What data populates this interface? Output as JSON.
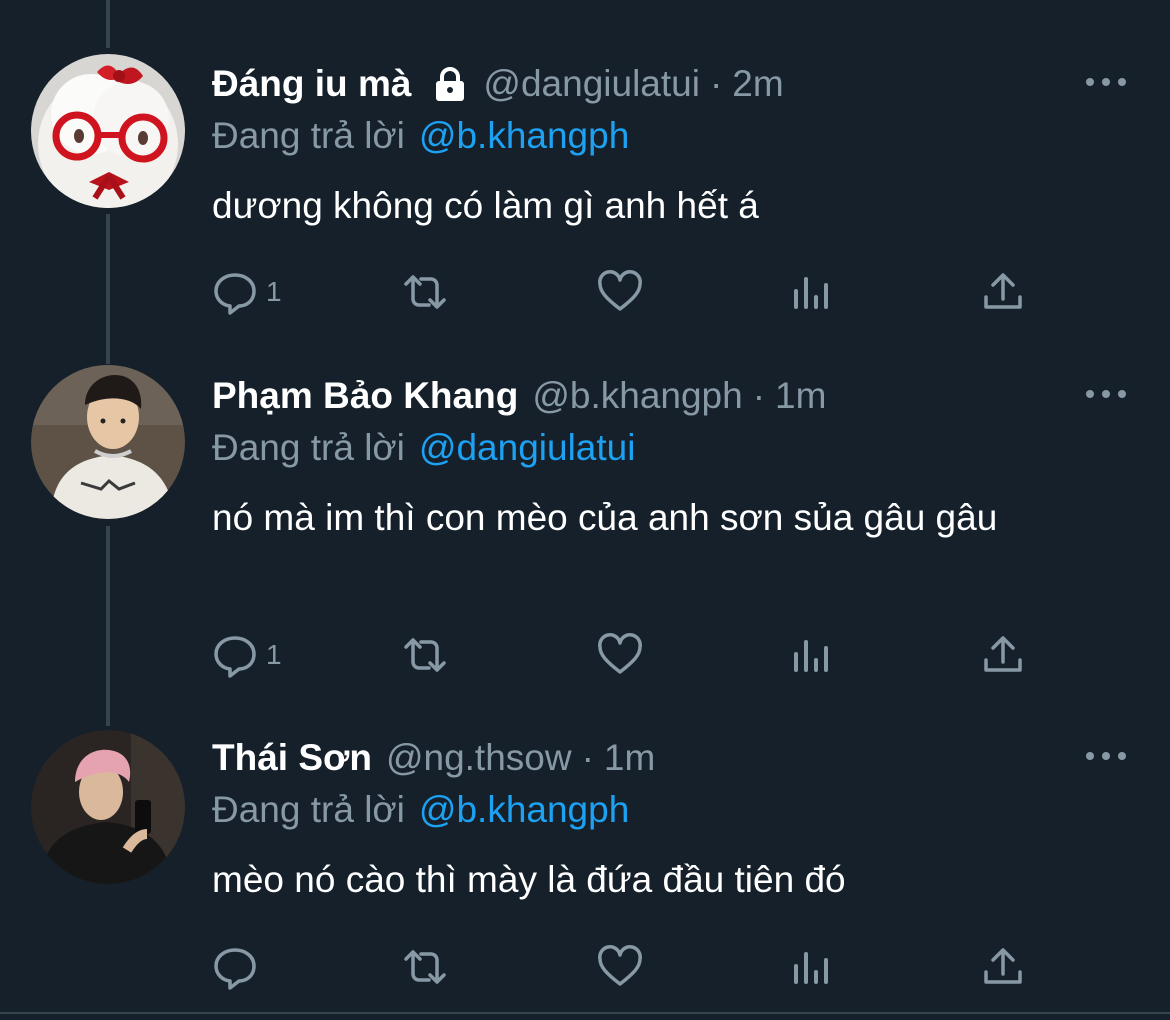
{
  "colors": {
    "background": "#15202b",
    "muted": "#8899a6",
    "link": "#1da1f2",
    "divider": "#38444d"
  },
  "tweets": [
    {
      "display_name": "Đáng iu mà",
      "locked": true,
      "handle": "@dangiulatui",
      "separator": "·",
      "time": "2m",
      "reply_prefix": "Đang trả lời",
      "reply_to": "@b.khangph",
      "text": "dương không có làm gì anh hết á",
      "reply_count": "1",
      "avatar_icon": "plush-bear-with-glasses"
    },
    {
      "display_name": "Phạm Bảo Khang",
      "locked": false,
      "handle": "@b.khangph",
      "separator": "·",
      "time": "1m",
      "reply_prefix": "Đang trả lời",
      "reply_to": "@dangiulatui",
      "text": "nó mà im thì con mèo của anh sơn sủa gâu gâu",
      "reply_count": "1",
      "avatar_icon": "person-photo"
    },
    {
      "display_name": "Thái Sơn",
      "locked": false,
      "handle": "@ng.thsow",
      "separator": "·",
      "time": "1m",
      "reply_prefix": "Đang trả lời",
      "reply_to": "@b.khangph",
      "text": "mèo nó cào thì mày là đứa đầu tiên đó",
      "reply_count": "",
      "avatar_icon": "person-mirror-selfie"
    }
  ],
  "action_icons": [
    "reply-icon",
    "retweet-icon",
    "like-icon",
    "analytics-icon",
    "share-icon"
  ]
}
